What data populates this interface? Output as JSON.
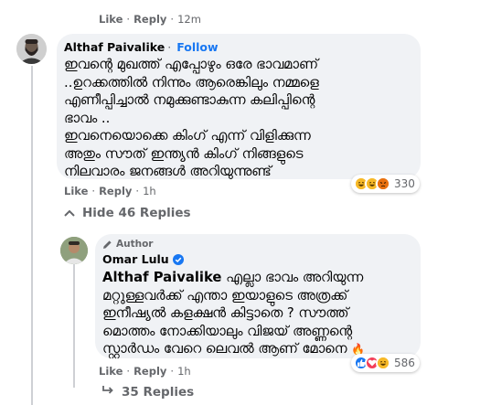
{
  "top_comment": {
    "like_label": "Like",
    "reply_label": "Reply",
    "time": "12m"
  },
  "comment": {
    "author": "Althaf Paivalike",
    "follow_label": "Follow",
    "separator": "·",
    "lines": [
      "ഇവന്റെ മുഖത്ത് എപ്പോഴും ഒരേ ഭാവമാണ്",
      "..ഉറക്കത്തിൽ നിന്നും ആരെങ്കിലും നമ്മളെ",
      "എണീപ്പിച്ചാൽ നമുക്കുണ്ടാകുന്ന കലിപ്പിന്റെ",
      "ഭാവം ..",
      "ഇവനെയൊക്കെ കിംഗ് എന്ന് വിളിക്കുന്ന",
      "അതും സൗത് ഇന്ത്യൻ കിംഗ് നിങ്ങളുടെ",
      "നിലവാരം ജനങ്ങൾ അറിയുന്നുണ്ട്"
    ],
    "like_label": "Like",
    "reply_label": "Reply",
    "time": "1h",
    "reactions": [
      "haha",
      "haha-2",
      "angry"
    ],
    "reaction_count": "330"
  },
  "hide_replies": {
    "label": "Hide 46 Replies",
    "icon": "chevron-up-icon"
  },
  "reply": {
    "badge_label": "Author",
    "badge_icon": "pen-icon",
    "author": "Omar Lulu",
    "verified_icon": "verified-badge-icon",
    "mention": "Althaf Paivalike",
    "lines": [
      " എല്ലാ ഭാവം അറിയുന്ന",
      "മറ്റുള്ളവർക്ക് എന്താ ഇയാളുടെ അത്രക്ക്",
      "ഇനീഷ്യൽ കളക്ഷൻ കിട്ടാതെ ? സൗത്ത്",
      "മൊത്തം നോക്കിയാലും വിജയ് അണ്ണന്റെ",
      "സ്റ്റാർഡം വേറെ ലെവൽ ആണ് മോനെ"
    ],
    "fire_emoji": "🔥",
    "like_label": "Like",
    "reply_label": "Reply",
    "time": "1h",
    "reactions": [
      "like",
      "love",
      "haha"
    ],
    "reaction_count": "586"
  },
  "more_replies": {
    "label": "35 Replies",
    "icon": "reply-arrow-icon"
  },
  "colors": {
    "bubble": "#f0f2f5",
    "link_blue": "#1877f2",
    "meta_grey": "#65676b",
    "thread_line": "#ced0d4"
  }
}
